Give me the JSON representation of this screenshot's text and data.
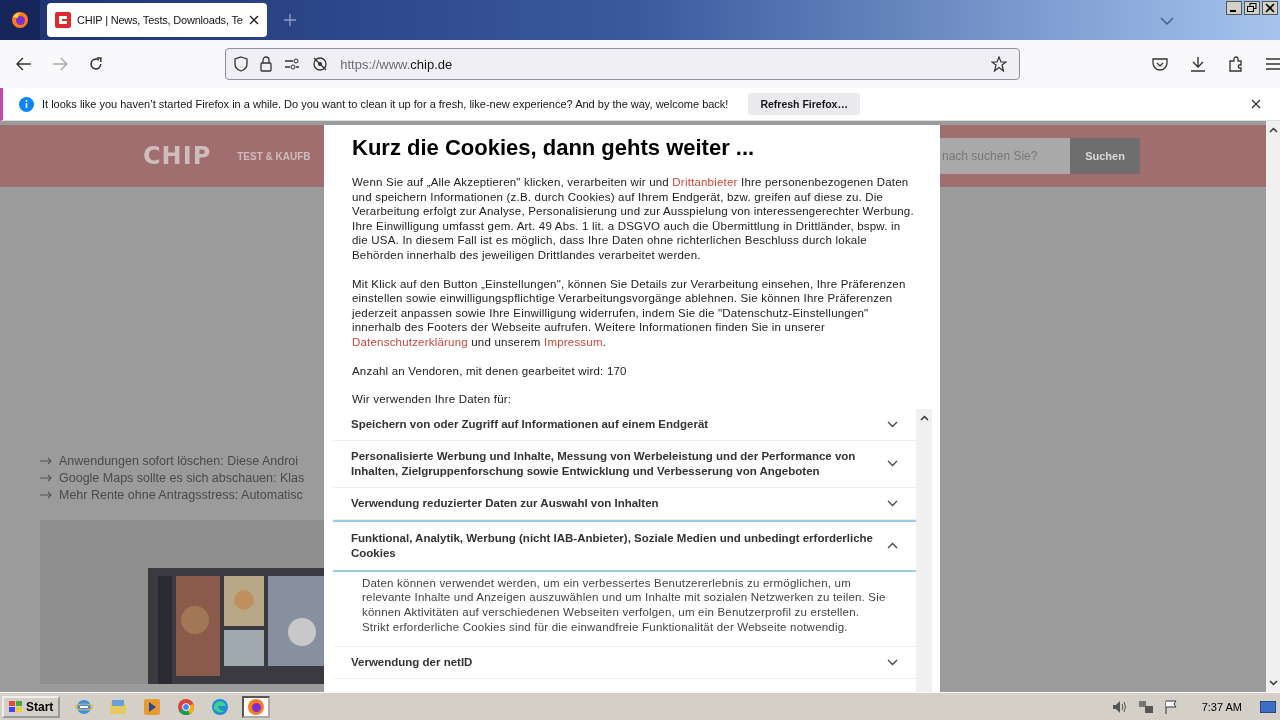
{
  "browser": {
    "tab": {
      "title": "CHIP | News, Tests, Downloads, Te",
      "selected": true
    },
    "url_prefix": "https://www.",
    "url_host": "chip.de"
  },
  "notification": {
    "text": "It looks like you haven’t started Firefox in a while. Do you want to clean it up for a fresh, like-new experience? And by the way, welcome back!",
    "button": "Refresh Firefox…"
  },
  "site": {
    "logo": "CHIP",
    "nav_item": "TEST & KAUFB",
    "search_placeholder": "nach suchen Sie?",
    "search_button": "Suchen",
    "headlines": [
      "Anwendungen sofort löschen: Diese Androi",
      "Google Maps sollte es sich abschauen: Klas",
      "Mehr Rente ohne Antragsstress: Automatisc"
    ]
  },
  "consent": {
    "title": "Kurz die Cookies, dann gehts weiter ...",
    "paragraphs": [
      [
        {
          "kind": "text",
          "text": "Wenn Sie auf „Alle Akzeptieren\" klicken, verarbeiten wir und "
        },
        {
          "kind": "link",
          "text": "Drittanbieter"
        },
        {
          "kind": "text",
          "text": " Ihre personenbezogenen Daten und speichern Informationen (z.B. durch Cookies) auf Ihrem Endgerät, bzw. greifen auf diese zu. Die Verarbeitung erfolgt zur Analyse, Personalisierung und zur Ausspielung von interessengerechter Werbung. Ihre Einwilligung umfasst gem. Art. 49 Abs. 1 lit. a DSGVO auch die Übermittlung in Drittländer, bspw. in die USA. In diesem Fall ist es möglich, dass Ihre Daten ohne richterlichen Beschluss durch lokale Behörden innerhalb des jeweiligen Drittlandes verarbeitet werden."
        }
      ],
      [
        {
          "kind": "text",
          "text": "Mit Klick auf den Button „Einstellungen\", können Sie Details zur Verarbeitung einsehen, Ihre Präferenzen einstellen sowie einwilligungspflichtige Verarbeitungsvorgänge ablehnen. Sie können Ihre Präferenzen jederzeit anpassen sowie Ihre Einwilligung widerrufen, indem Sie die \"Datenschutz-Einstellungen\" innerhalb des Footers der Webseite aufrufen. Weitere Informationen finden Sie in unserer "
        },
        {
          "kind": "link",
          "text": "Datenschutzerklärung"
        },
        {
          "kind": "text",
          "text": " und unserem "
        },
        {
          "kind": "link",
          "text": "Impressum"
        },
        {
          "kind": "text",
          "text": "."
        }
      ],
      [
        {
          "kind": "text",
          "text": "Anzahl an Vendoren, mit denen gearbeitet wird: 170"
        }
      ],
      [
        {
          "kind": "text",
          "text": "Wir verwenden Ihre Daten für:"
        }
      ]
    ],
    "purposes": [
      {
        "title": "Speichern von oder Zugriff auf Informationen auf einem Endgerät",
        "expanded": false
      },
      {
        "title": "Personalisierte Werbung und Inhalte, Messung von Werbeleistung und der Performance von Inhalten, Zielgruppenforschung sowie Entwicklung und Verbesserung von Angeboten",
        "expanded": false
      },
      {
        "title": "Verwendung reduzierter Daten zur Auswahl von Inhalten",
        "expanded": false
      },
      {
        "title": "Funktional, Analytik, Werbung (nicht IAB-Anbieter), Soziale Medien und unbedingt erforderliche Cookies",
        "expanded": true,
        "description": "Daten können verwendet werden, um ein verbessertes Benutzererlebnis zu ermöglichen, um relevante Inhalte und Anzeigen auszuwählen und um Inhalte mit sozialen Netzwerken zu teilen. Sie können Aktivitäten auf verschiedenen Webseiten verfolgen, um ein Benutzerprofil zu erstellen. Strikt erforderliche Cookies sind für die einwandfreie Funktionalität der Webseite notwendig."
      },
      {
        "title": "Verwendung der netID",
        "expanded": false
      }
    ]
  },
  "taskbar": {
    "start": "Start",
    "apps": [
      {
        "kind": "ie",
        "selected": false
      },
      {
        "kind": "folder",
        "selected": false
      },
      {
        "kind": "media",
        "selected": false
      },
      {
        "kind": "chrome",
        "selected": false
      },
      {
        "kind": "edge",
        "selected": false
      },
      {
        "kind": "firefox",
        "selected": true
      }
    ],
    "time": "7:37 AM"
  }
}
